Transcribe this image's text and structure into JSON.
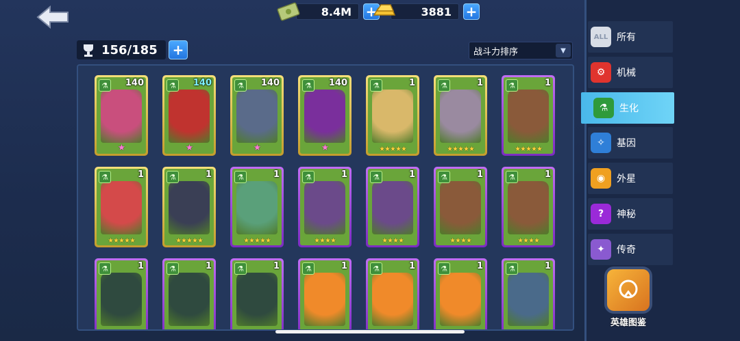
{
  "currency": {
    "cash": "8.4M",
    "gold": "3881"
  },
  "capacity": "156/185",
  "sort": {
    "selected": "战斗力排序"
  },
  "cards": [
    {
      "level": "140",
      "stars": "★",
      "frame": "gold",
      "star_style": "pink",
      "level_style": "",
      "art": "#c94f7d"
    },
    {
      "level": "140",
      "stars": "★",
      "frame": "gold",
      "star_style": "pink",
      "level_style": "cyan",
      "art": "#c0332f"
    },
    {
      "level": "140",
      "stars": "★",
      "frame": "gold",
      "star_style": "pink",
      "level_style": "",
      "art": "#5a6b8a"
    },
    {
      "level": "140",
      "stars": "★",
      "frame": "gold",
      "star_style": "pink",
      "level_style": "",
      "art": "#7a2f9c"
    },
    {
      "level": "1",
      "stars": "★★★★★",
      "frame": "gold",
      "star_style": "",
      "level_style": "",
      "art": "#d9b86a"
    },
    {
      "level": "1",
      "stars": "★★★★★",
      "frame": "gold",
      "star_style": "",
      "level_style": "",
      "art": "#9a8aa0"
    },
    {
      "level": "1",
      "stars": "★★★★★",
      "frame": "purple",
      "star_style": "",
      "level_style": "",
      "art": "#8a5a3a"
    },
    {
      "level": "1",
      "stars": "★★★★★",
      "frame": "gold",
      "star_style": "",
      "level_style": "",
      "art": "#d44a4a"
    },
    {
      "level": "1",
      "stars": "★★★★★",
      "frame": "gold",
      "star_style": "",
      "level_style": "",
      "art": "#3a3f55"
    },
    {
      "level": "1",
      "stars": "★★★★★",
      "frame": "purple",
      "star_style": "",
      "level_style": "",
      "art": "#5aa07a"
    },
    {
      "level": "1",
      "stars": "★★★★",
      "frame": "purple",
      "star_style": "",
      "level_style": "",
      "art": "#6b4a8a"
    },
    {
      "level": "1",
      "stars": "★★★★",
      "frame": "purple",
      "star_style": "",
      "level_style": "",
      "art": "#6b4a8a"
    },
    {
      "level": "1",
      "stars": "★★★★",
      "frame": "purple",
      "star_style": "",
      "level_style": "",
      "art": "#8a5a3a"
    },
    {
      "level": "1",
      "stars": "★★★★",
      "frame": "purple",
      "star_style": "",
      "level_style": "",
      "art": "#8a5a3a"
    },
    {
      "level": "1",
      "stars": "",
      "frame": "purple",
      "star_style": "",
      "level_style": "",
      "art": "#2f4a3f"
    },
    {
      "level": "1",
      "stars": "",
      "frame": "purple",
      "star_style": "",
      "level_style": "",
      "art": "#2f4a3f"
    },
    {
      "level": "1",
      "stars": "",
      "frame": "purple",
      "star_style": "",
      "level_style": "",
      "art": "#2f4a3f"
    },
    {
      "level": "1",
      "stars": "",
      "frame": "purple",
      "star_style": "",
      "level_style": "",
      "art": "#f08a2a"
    },
    {
      "level": "1",
      "stars": "",
      "frame": "purple",
      "star_style": "",
      "level_style": "",
      "art": "#f08a2a"
    },
    {
      "level": "1",
      "stars": "",
      "frame": "purple",
      "star_style": "",
      "level_style": "",
      "art": "#f08a2a"
    },
    {
      "level": "1",
      "stars": "",
      "frame": "purple",
      "star_style": "",
      "level_style": "",
      "art": "#4a6a8a"
    }
  ],
  "sidebar": {
    "items": [
      {
        "label": "所有",
        "icon": "all-icon",
        "icon_text": "ALL",
        "color": "#d8dde6",
        "active": false
      },
      {
        "label": "机械",
        "icon": "mech-icon",
        "icon_text": "⚙",
        "color": "#e0342e",
        "active": false
      },
      {
        "label": "生化",
        "icon": "flask-icon",
        "icon_text": "⚗",
        "color": "#2f9a3b",
        "active": true
      },
      {
        "label": "基因",
        "icon": "dna-icon",
        "icon_text": "✧",
        "color": "#2f7fd8",
        "active": false
      },
      {
        "label": "外星",
        "icon": "alien-icon",
        "icon_text": "◉",
        "color": "#f0a020",
        "active": false
      },
      {
        "label": "神秘",
        "icon": "mystery-icon",
        "icon_text": "?",
        "color": "#9a2ad8",
        "active": false
      },
      {
        "label": "传奇",
        "icon": "legend-icon",
        "icon_text": "✦",
        "color": "#8a5ad0",
        "active": false
      }
    ],
    "collection_label": "英雄图鉴"
  }
}
